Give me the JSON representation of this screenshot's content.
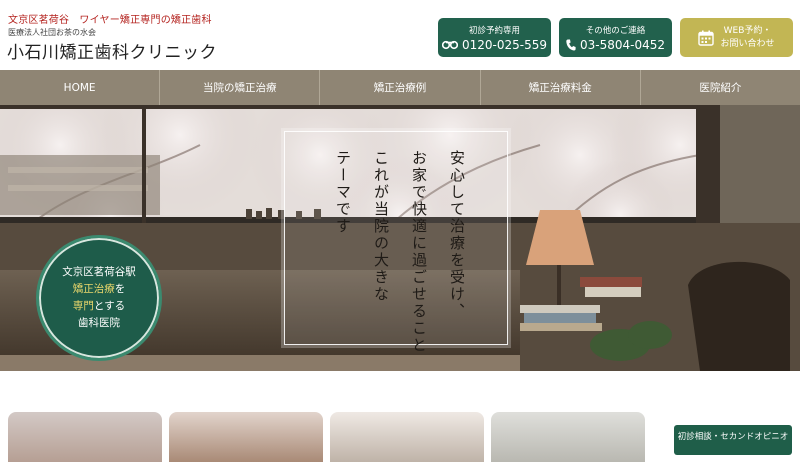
{
  "header": {
    "tagline": "文京区茗荷谷　ワイヤー矯正専門の矯正歯科",
    "corporation": "医療法人社団お茶の水会",
    "clinic_name": "小石川矯正歯科クリニック",
    "buttons": {
      "first_visit": {
        "caption": "初診予約専用",
        "phone": "0120-025-559",
        "icon": "free-dial-icon"
      },
      "other": {
        "caption": "その他のご連絡",
        "phone": "03-5804-0452",
        "icon": "phone-icon"
      },
      "web": {
        "line1": "WEB予約・",
        "line2": "お問い合わせ",
        "icon": "calendar-icon"
      }
    }
  },
  "nav": {
    "items": [
      "HOME",
      "当院の矯正治療",
      "矯正治療例",
      "矯正治療料金",
      "医院紹介"
    ]
  },
  "hero": {
    "copy_lines": [
      "安心して治療を受け、",
      "お家で快適に過ごせること",
      "これが当院の大きな",
      "テーマです"
    ],
    "badge": {
      "line1": "文京区茗荷谷駅",
      "line2_highlight": "矯正治療",
      "line2_suffix": "を",
      "line3_highlight": "専門",
      "line3_suffix": "とする",
      "line4": "歯科医院"
    }
  },
  "consult_button": {
    "label": "初診相談・セカンドオピニオン"
  },
  "colors": {
    "brand_green": "#22614d",
    "accent_gold": "#c2b654",
    "nav_bg": "#8f8574",
    "tagline_red": "#b4231f"
  }
}
